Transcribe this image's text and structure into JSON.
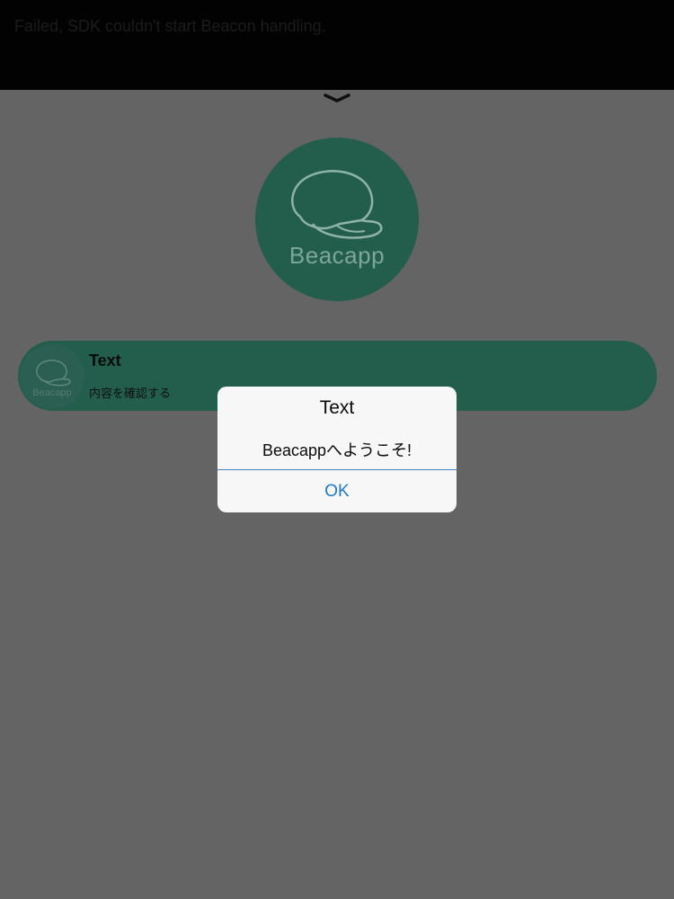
{
  "status_banner": {
    "message": "Failed, SDK couldn't start Beacon handling."
  },
  "chevron": {
    "icon": "chevron-down-icon"
  },
  "logo": {
    "icon": "beacapp-logo-icon",
    "text": "Beacapp"
  },
  "notification": {
    "icon": "beacapp-logo-icon",
    "icon_text": "Beacapp",
    "title": "Text",
    "subtitle": "内容を確認する"
  },
  "alert": {
    "title": "Text",
    "message": "Beacappへようこそ!",
    "ok_label": "OK"
  },
  "colors": {
    "dim_overlay": "#656465",
    "banner": "#020203",
    "brand_green": "#235d4c",
    "alert_background": "#f7f7f7",
    "link_blue": "#1f78c9"
  }
}
